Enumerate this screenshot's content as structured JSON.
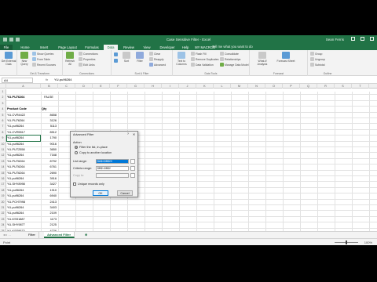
{
  "window": {
    "title": "Case Sensitive Filter - Excel",
    "user": "Sean Ferris"
  },
  "tabs": [
    "File",
    "Home",
    "Insert",
    "Page Layout",
    "Formulas",
    "Data",
    "Review",
    "View",
    "Developer",
    "Help",
    "MY MACROS"
  ],
  "active_tab": "Data",
  "tell_me": "Tell me what you want to do",
  "ribbon": {
    "groups": [
      "Get & Transform",
      "Connections",
      "Sort & Filter",
      "Data Tools",
      "Forecast",
      "Outline"
    ],
    "get_data": "Get External Data",
    "new_query": "New Query",
    "show_queries": "Show Queries",
    "from_table": "From Table",
    "recent_sources": "Recent Sources",
    "refresh_all": "Refresh All",
    "connections": "Connections",
    "properties": "Properties",
    "edit_links": "Edit Links",
    "sort": "Sort",
    "filter": "Filter",
    "clear": "Clear",
    "reapply": "Reapply",
    "advanced": "Advanced",
    "text_to_columns": "Text to Columns",
    "flash_fill": "Flash Fill",
    "remove_duplicates": "Remove Duplicates",
    "data_validation": "Data Validation",
    "consolidate": "Consolidate",
    "relationships": "Relationships",
    "manage_data_model": "Manage Data Model",
    "what_if": "What-If Analysis",
    "forecast_sheet": "Forecast Sheet",
    "group": "Group",
    "ungroup": "Ungroup",
    "subtotal": "Subtotal"
  },
  "formula_bar": {
    "name_box": "A4",
    "fx": "fx",
    "value": "YU-pu96264"
  },
  "columns": [
    "A",
    "B",
    "C",
    "D",
    "E",
    "F",
    "G",
    "H",
    "I",
    "J",
    "K",
    "L",
    "M",
    "N",
    "O",
    "P",
    "Q",
    "R",
    "S",
    "T"
  ],
  "rows": [
    {
      "n": "1",
      "a": "",
      "b": ""
    },
    {
      "n": "2",
      "a": "YU-PU76264",
      "b": "FALSE"
    },
    {
      "n": "3",
      "a": "",
      "b": ""
    },
    {
      "n": "4",
      "a": "Product Code",
      "b": "Qty"
    },
    {
      "n": "5",
      "a": "YU-CVR4422",
      "b": "8658"
    },
    {
      "n": "6",
      "a": "YU-PU76264",
      "b": "3126"
    },
    {
      "n": "7",
      "a": "YU-pu96264",
      "b": "5113"
    },
    {
      "n": "8",
      "a": "YU-CVR5517",
      "b": "8512"
    },
    {
      "n": "9",
      "a": "YU-pu96264",
      "b": "1790"
    },
    {
      "n": "10",
      "a": "YU-pu96264",
      "b": "9016"
    },
    {
      "n": "11",
      "a": "YU-PUT2558",
      "b": "3650"
    },
    {
      "n": "12",
      "a": "YU-pu96264",
      "b": "7168"
    },
    {
      "n": "13",
      "a": "YU-PUT6264",
      "b": "8792"
    },
    {
      "n": "14",
      "a": "YU-PUT6264",
      "b": "6761"
    },
    {
      "n": "15",
      "a": "YU-PUT6264",
      "b": "2690"
    },
    {
      "n": "16",
      "a": "YU-pu96264",
      "b": "3916"
    },
    {
      "n": "17",
      "a": "YU-SHY8998",
      "b": "3427"
    },
    {
      "n": "18",
      "a": "YU-pu96264",
      "b": "1910"
    },
    {
      "n": "19",
      "a": "YU-pu96264",
      "b": "6940"
    },
    {
      "n": "20",
      "a": "YU-PCH7998",
      "b": "2413"
    },
    {
      "n": "21",
      "a": "YU-pu96264",
      "b": "3403"
    },
    {
      "n": "22",
      "a": "YU-pu96264",
      "b": "2109"
    },
    {
      "n": "23",
      "a": "YU-KSS1887",
      "b": "1173"
    },
    {
      "n": "24",
      "a": "YU-SHY9877",
      "b": "2125"
    },
    {
      "n": "25",
      "a": "YU-KSS9573",
      "b": "4226"
    },
    {
      "n": "26",
      "a": "YU-SHY5201",
      "b": "3257"
    }
  ],
  "dialog": {
    "title": "Advanced Filter",
    "help": "?",
    "close": "✕",
    "action_label": "Action",
    "option_in_place": "Filter the list, in-place",
    "option_copy": "Copy to another location",
    "list_range_label": "List range:",
    "list_range_value": "$A$4:$B$23",
    "criteria_range_label": "Criteria range:",
    "criteria_range_value": "$B$1:$B$2",
    "copy_to_label": "Copy to:",
    "copy_to_value": "",
    "unique_label": "Unique records only",
    "ok": "OK",
    "cancel": "Cancel"
  },
  "sheets": [
    "Filter",
    "Advanced Filter"
  ],
  "active_sheet": "Advanced Filter",
  "status": {
    "ready": "Point",
    "zoom": "100%"
  },
  "colors": {
    "excel_green": "#217346",
    "selection": "#0078d7"
  }
}
